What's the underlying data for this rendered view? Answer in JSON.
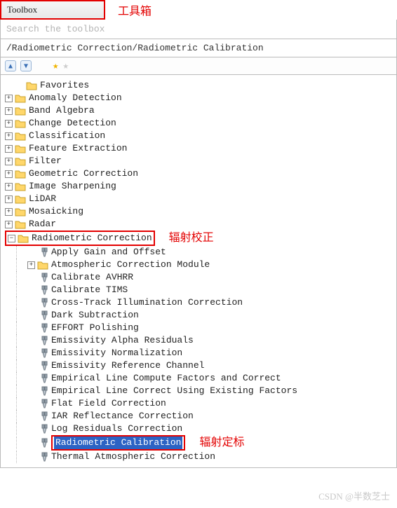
{
  "title": "Toolbox",
  "title_annotation": "工具箱",
  "search_placeholder": "Search the toolbox",
  "breadcrumb": "/Radiometric Correction/Radiometric Calibration",
  "toolbar": {
    "expand_all": "▲",
    "collapse_all": "▼"
  },
  "annotations": {
    "radiometric_correction": "辐射校正",
    "radiometric_calibration": "辐射定标"
  },
  "tree": {
    "favorites": "Favorites",
    "top_folders": [
      "Anomaly Detection",
      "Band Algebra",
      "Change Detection",
      "Classification",
      "Feature Extraction",
      "Filter",
      "Geometric Correction",
      "Image Sharpening",
      "LiDAR",
      "Mosaicking",
      "Radar"
    ],
    "rad_corr": "Radiometric Correction",
    "rad_children": [
      "Apply Gain and Offset",
      "Atmospheric Correction Module",
      "Calibrate AVHRR",
      "Calibrate TIMS",
      "Cross-Track Illumination Correction",
      "Dark Subtraction",
      "EFFORT Polishing",
      "Emissivity Alpha Residuals",
      "Emissivity Normalization",
      "Emissivity Reference Channel",
      "Empirical Line Compute Factors and Correct",
      "Empirical Line Correct Using Existing Factors",
      "Flat Field Correction",
      "IAR Reflectance Correction",
      "Log Residuals Correction",
      "Radiometric Calibration",
      "Thermal Atmospheric Correction"
    ]
  },
  "watermark": "CSDN @半数芝士"
}
